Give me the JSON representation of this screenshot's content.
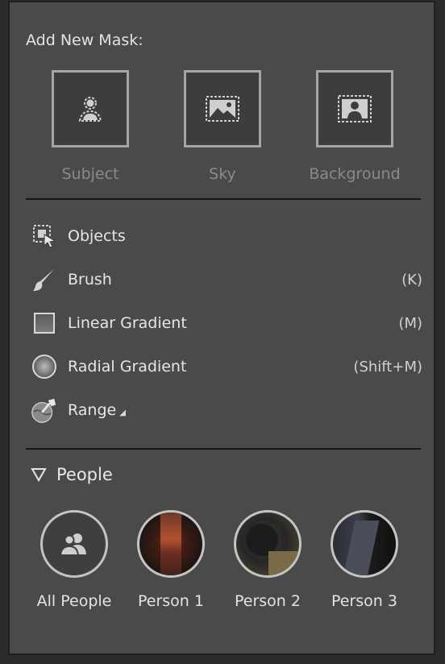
{
  "panel": {
    "title": "Add New Mask:"
  },
  "quick_masks": [
    {
      "label": "Subject",
      "icon": "subject-mask-icon"
    },
    {
      "label": "Sky",
      "icon": "sky-mask-icon"
    },
    {
      "label": "Background",
      "icon": "background-mask-icon"
    }
  ],
  "tools": [
    {
      "label": "Objects",
      "shortcut": "",
      "icon": "objects-icon"
    },
    {
      "label": "Brush",
      "shortcut": "(K)",
      "icon": "brush-icon"
    },
    {
      "label": "Linear Gradient",
      "shortcut": "(M)",
      "icon": "linear-gradient-icon"
    },
    {
      "label": "Radial Gradient",
      "shortcut": "(Shift+M)",
      "icon": "radial-gradient-icon"
    },
    {
      "label": "Range",
      "shortcut": "",
      "icon": "range-icon"
    }
  ],
  "people": {
    "header": "People",
    "items": [
      {
        "label": "All People"
      },
      {
        "label": "Person 1"
      },
      {
        "label": "Person 2"
      },
      {
        "label": "Person 3"
      }
    ]
  },
  "colors": {
    "panel_bg": "#4a4a4a",
    "text": "#e3e3e3",
    "muted": "#8a8a8a",
    "tile_border": "#a5a5a5"
  }
}
